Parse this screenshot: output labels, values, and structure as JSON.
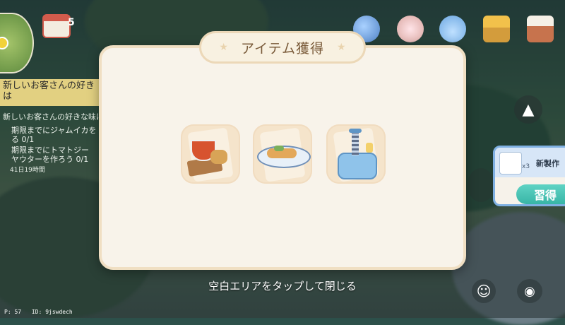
{
  "hud": {
    "calendar_count": "5",
    "quest_title": "新しいお客さんの好き\nは",
    "quest_subtitle": "新しいお客さんの好きな味は",
    "quest_lines": [
      "期限までにジャムイカを\nる 0/1",
      "期限までにトマトジー\nヤウターを作ろう 0/1"
    ],
    "quest_timer": "41日19時間",
    "status_p": "P: 57",
    "status_id": "ID: 9jswdech"
  },
  "dialog": {
    "title": "アイテム獲得",
    "items": [
      {
        "icon": "soup-bread-dish-icon"
      },
      {
        "icon": "grilled-fish-plate-icon"
      },
      {
        "icon": "blue-machine-icon"
      }
    ],
    "close_hint": "空白エリアをタップして閉じる"
  },
  "new_recipe": {
    "label": "新製作",
    "multiplier": "x3",
    "learn_button": "習得"
  },
  "colors": {
    "dialog_bg": "#f8f3ea",
    "title_text": "#7a5b3a",
    "learn_button": "#38b5a6"
  }
}
